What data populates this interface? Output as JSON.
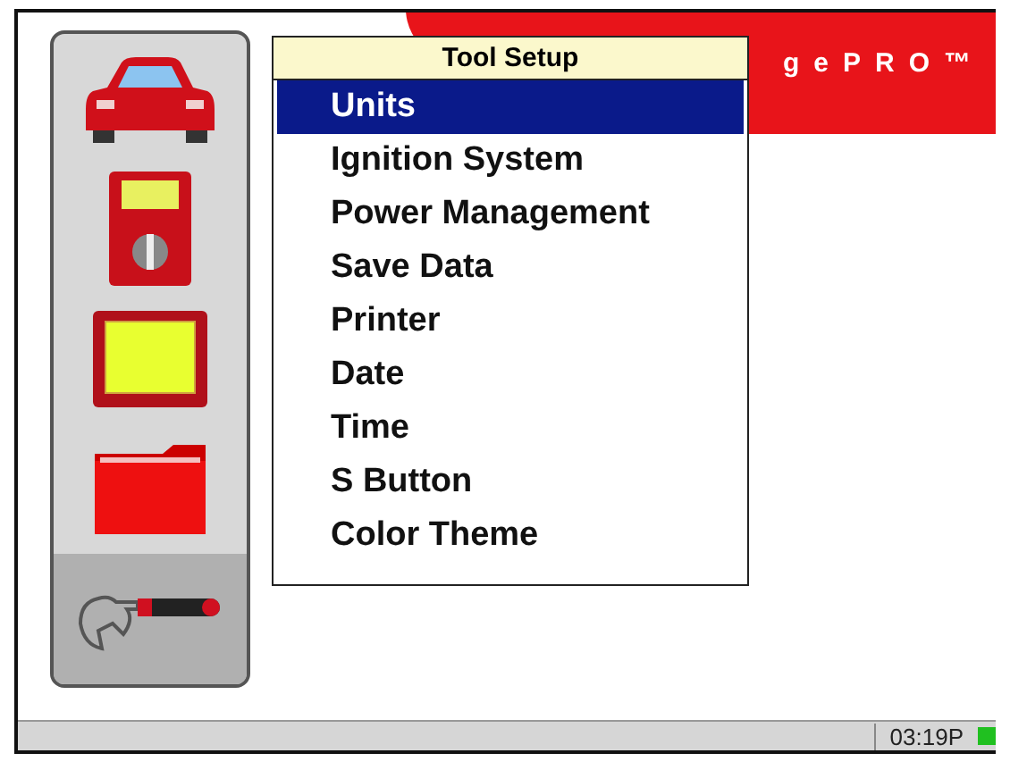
{
  "sidebar": {
    "items": [
      {
        "kind": "vehicle",
        "selected": false
      },
      {
        "kind": "meter",
        "selected": false
      },
      {
        "kind": "scope",
        "selected": false
      },
      {
        "kind": "folder",
        "selected": false
      },
      {
        "kind": "tools",
        "selected": true
      }
    ]
  },
  "banner": {
    "text": "gePRO™"
  },
  "menu": {
    "title": "Tool Setup",
    "items": [
      {
        "label": "Units",
        "selected": true
      },
      {
        "label": "Ignition System",
        "selected": false
      },
      {
        "label": "Power Management",
        "selected": false
      },
      {
        "label": "Save Data",
        "selected": false
      },
      {
        "label": "Printer",
        "selected": false
      },
      {
        "label": "Date",
        "selected": false
      },
      {
        "label": "Time",
        "selected": false
      },
      {
        "label": "S Button",
        "selected": false
      },
      {
        "label": "Color Theme",
        "selected": false
      }
    ]
  },
  "status_bar": {
    "time": "03:19P"
  }
}
